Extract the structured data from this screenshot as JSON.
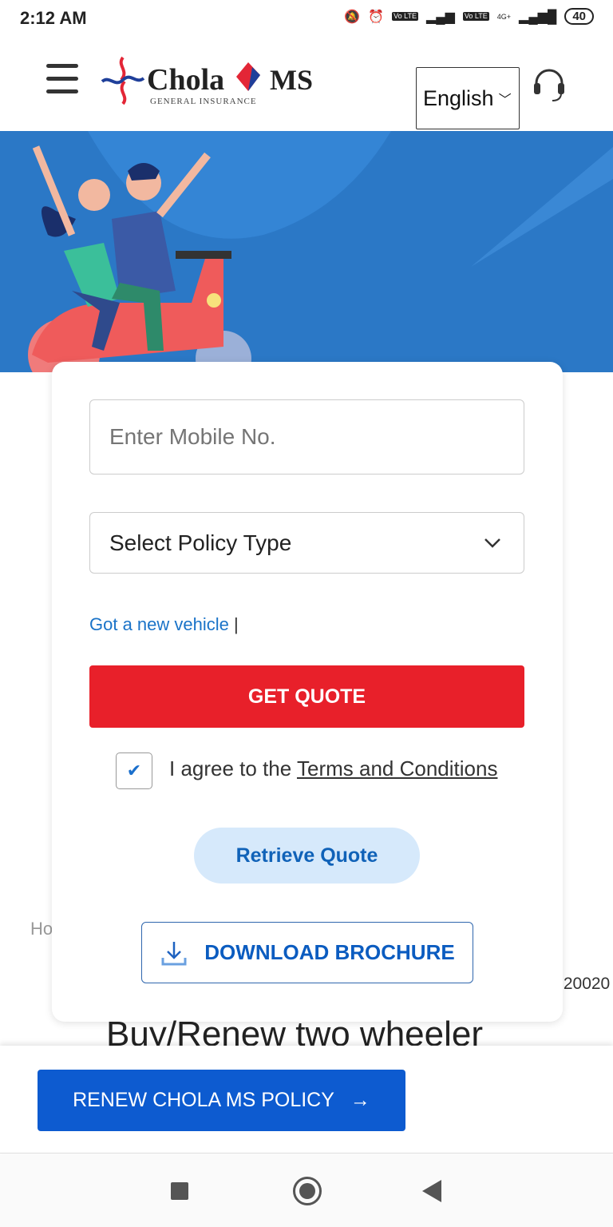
{
  "status_bar": {
    "time": "2:12 AM",
    "battery": "40",
    "network": "4G+",
    "volte": "Vo LTE"
  },
  "header": {
    "logo_text": "Chola MS",
    "logo_subtext": "GENERAL INSURANCE",
    "language": "English"
  },
  "form": {
    "mobile_placeholder": "Enter Mobile No.",
    "policy_type": "Select Policy Type",
    "new_vehicle_link": "Got a new vehicle",
    "new_vehicle_sep": "|",
    "get_quote": "GET QUOTE",
    "agree_prefix": "I agree to the ",
    "terms_link": "Terms and Conditions",
    "terms_checked": true,
    "retrieve_quote": "Retrieve Quote",
    "download_brochure": "DOWNLOAD BROCHURE"
  },
  "background": {
    "partial_left": "Ho",
    "partial_right": ":20020",
    "heading": "Buy/Renew two wheeler"
  },
  "bottom_bar": {
    "renew_button": "RENEW CHOLA MS POLICY"
  },
  "colors": {
    "primary_blue": "#0d5bd0",
    "quote_red": "#e8202a",
    "hero_blue": "#2b78c6"
  }
}
